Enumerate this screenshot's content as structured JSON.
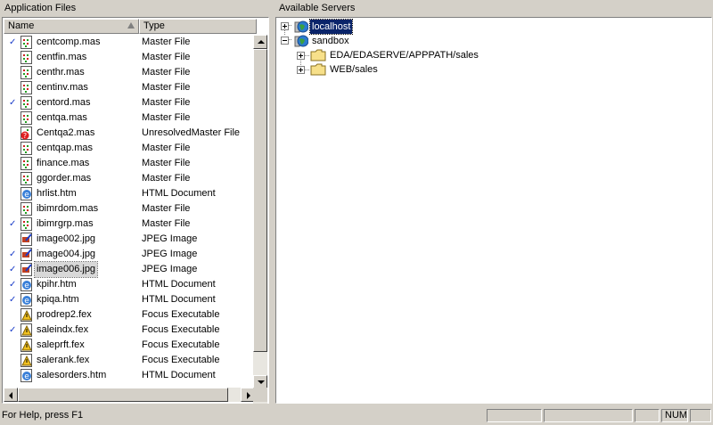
{
  "left_panel": {
    "title": "Application Files",
    "columns": {
      "name": "Name",
      "type": "Type"
    },
    "files": [
      {
        "name": "centcomp.mas",
        "type": "Master File",
        "checked": true,
        "icon": "master-file-icon"
      },
      {
        "name": "centfin.mas",
        "type": "Master File",
        "checked": false,
        "icon": "master-file-icon"
      },
      {
        "name": "centhr.mas",
        "type": "Master File",
        "checked": false,
        "icon": "master-file-icon"
      },
      {
        "name": "centinv.mas",
        "type": "Master File",
        "checked": false,
        "icon": "master-file-icon"
      },
      {
        "name": "centord.mas",
        "type": "Master File",
        "checked": true,
        "icon": "master-file-icon"
      },
      {
        "name": "centqa.mas",
        "type": "Master File",
        "checked": false,
        "icon": "master-file-icon"
      },
      {
        "name": "Centqa2.mas",
        "type": "UnresolvedMaster File",
        "checked": false,
        "icon": "unresolved-master-icon"
      },
      {
        "name": "centqap.mas",
        "type": "Master File",
        "checked": false,
        "icon": "master-file-icon"
      },
      {
        "name": "finance.mas",
        "type": "Master File",
        "checked": false,
        "icon": "master-file-icon"
      },
      {
        "name": "ggorder.mas",
        "type": "Master File",
        "checked": false,
        "icon": "master-file-icon"
      },
      {
        "name": "hrlist.htm",
        "type": "HTML Document",
        "checked": false,
        "icon": "html-document-icon"
      },
      {
        "name": "ibimrdom.mas",
        "type": "Master File",
        "checked": false,
        "icon": "master-file-icon"
      },
      {
        "name": "ibimrgrp.mas",
        "type": "Master File",
        "checked": true,
        "icon": "master-file-icon"
      },
      {
        "name": "image002.jpg",
        "type": "JPEG Image",
        "checked": false,
        "icon": "jpeg-image-icon"
      },
      {
        "name": "image004.jpg",
        "type": "JPEG Image",
        "checked": true,
        "icon": "jpeg-image-icon"
      },
      {
        "name": "image006.jpg",
        "type": "JPEG Image",
        "checked": true,
        "icon": "jpeg-image-icon",
        "selected": true
      },
      {
        "name": "kpihr.htm",
        "type": "HTML Document",
        "checked": true,
        "icon": "html-document-icon"
      },
      {
        "name": "kpiqa.htm",
        "type": "HTML Document",
        "checked": true,
        "icon": "html-document-icon"
      },
      {
        "name": "prodrep2.fex",
        "type": "Focus Executable",
        "checked": false,
        "icon": "focus-executable-icon"
      },
      {
        "name": "saleindx.fex",
        "type": "Focus Executable",
        "checked": true,
        "icon": "focus-executable-icon"
      },
      {
        "name": "saleprft.fex",
        "type": "Focus Executable",
        "checked": false,
        "icon": "focus-executable-icon"
      },
      {
        "name": "salerank.fex",
        "type": "Focus Executable",
        "checked": false,
        "icon": "focus-executable-icon"
      },
      {
        "name": "salesorders.htm",
        "type": "HTML Document",
        "checked": false,
        "icon": "html-document-icon"
      }
    ]
  },
  "right_panel": {
    "title": "Available Servers",
    "tree": {
      "localhost": "localhost",
      "sandbox": "sandbox",
      "folder1": "EDA/EDASERVE/APPPATH/sales",
      "folder2": "WEB/sales"
    }
  },
  "status_bar": {
    "help_text": "For Help, press F1",
    "num": "NUM"
  },
  "colors": {
    "check": "#1a3cc8",
    "selection": "#0a246a",
    "window": "#d4d0c8"
  }
}
